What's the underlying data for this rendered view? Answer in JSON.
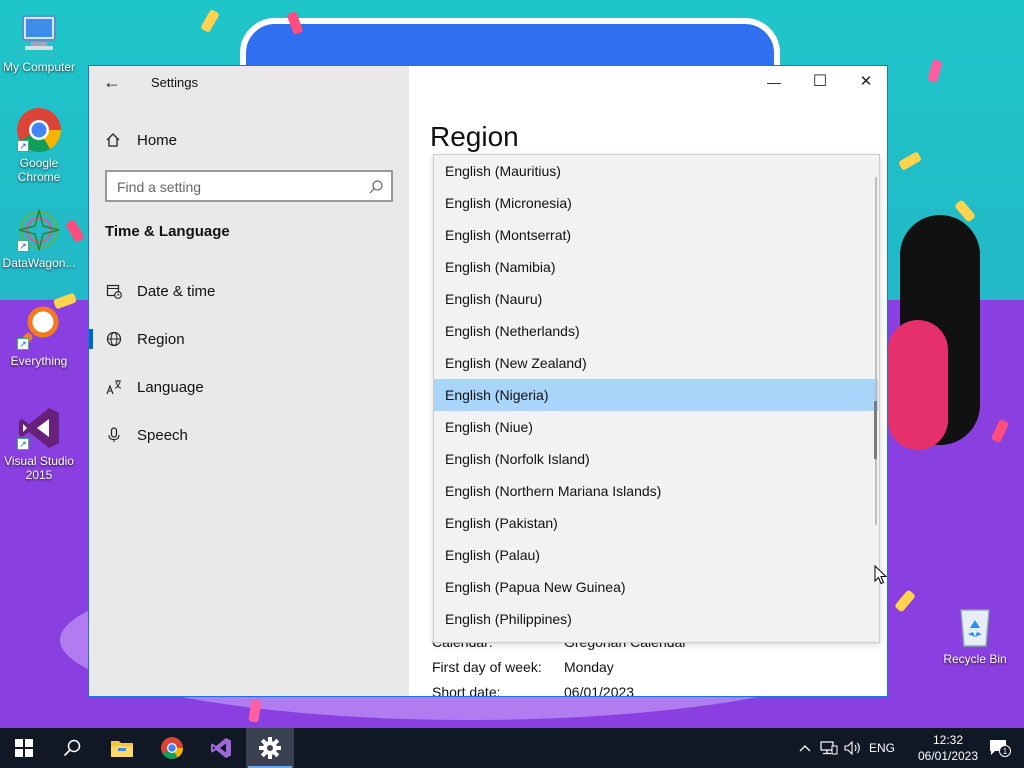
{
  "desktop": {
    "icons": [
      {
        "label": "My Computer"
      },
      {
        "label": "Google Chrome"
      },
      {
        "label": "DataWagon..."
      },
      {
        "label": "Everything"
      },
      {
        "label": "Visual Studio 2015"
      },
      {
        "label": "Recycle Bin"
      }
    ]
  },
  "window": {
    "title": "Settings",
    "back_glyph": "←",
    "minimize_glyph": "—",
    "maximize_glyph": "☐",
    "close_glyph": "✕"
  },
  "nav": {
    "home_label": "Home",
    "search_placeholder": "Find a setting",
    "section_title": "Time & Language",
    "items": [
      {
        "label": "Date & time",
        "icon": "calendar-clock-icon",
        "selected": false
      },
      {
        "label": "Region",
        "icon": "globe-icon",
        "selected": true
      },
      {
        "label": "Language",
        "icon": "language-icon",
        "selected": false
      },
      {
        "label": "Speech",
        "icon": "microphone-icon",
        "selected": false
      }
    ]
  },
  "content": {
    "heading": "Region",
    "properties": [
      {
        "key": "Calendar:",
        "value": "Gregorian Calendar"
      },
      {
        "key": "First day of week:",
        "value": "Monday"
      },
      {
        "key": "Short date:",
        "value": "06/01/2023"
      }
    ]
  },
  "dropdown": {
    "selected": "English (Nigeria)",
    "options": [
      "English (Mauritius)",
      "English (Micronesia)",
      "English (Montserrat)",
      "English (Namibia)",
      "English (Nauru)",
      "English (Netherlands)",
      "English (New Zealand)",
      "English (Nigeria)",
      "English (Niue)",
      "English (Norfolk Island)",
      "English (Northern Mariana Islands)",
      "English (Pakistan)",
      "English (Palau)",
      "English (Papua New Guinea)",
      "English (Philippines)"
    ]
  },
  "taskbar": {
    "input_lang": "ENG",
    "time": "12:32",
    "date": "06/01/2023",
    "notification_count": "1"
  },
  "colors": {
    "accent": "#0067c0",
    "highlight": "#a9d5fb",
    "taskbar": "#101826"
  }
}
